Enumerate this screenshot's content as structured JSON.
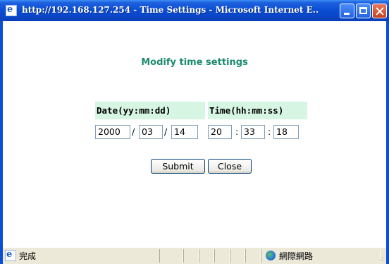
{
  "window": {
    "title": "http://192.168.127.254 - Time Settings - Microsoft Internet E...",
    "icon": "ie-page-icon"
  },
  "form": {
    "heading": "Modify time settings",
    "date_header": "Date(yy:mm:dd)",
    "time_header": "Time(hh:mm:ss)",
    "date": {
      "yy": "2000",
      "mm": "03",
      "dd": "14"
    },
    "time": {
      "hh": "20",
      "mm": "33",
      "ss": "18"
    },
    "date_sep": "/",
    "time_sep": ":",
    "submit_label": "Submit",
    "close_label": "Close"
  },
  "statusbar": {
    "status_text": "完成",
    "zone_text": "網際網路",
    "zone_icon": "globe-icon",
    "grip": ".:"
  },
  "colors": {
    "titlebar": "#0b4fd6",
    "heading": "#1b8a6f",
    "header_bg": "#d6f5e3"
  }
}
